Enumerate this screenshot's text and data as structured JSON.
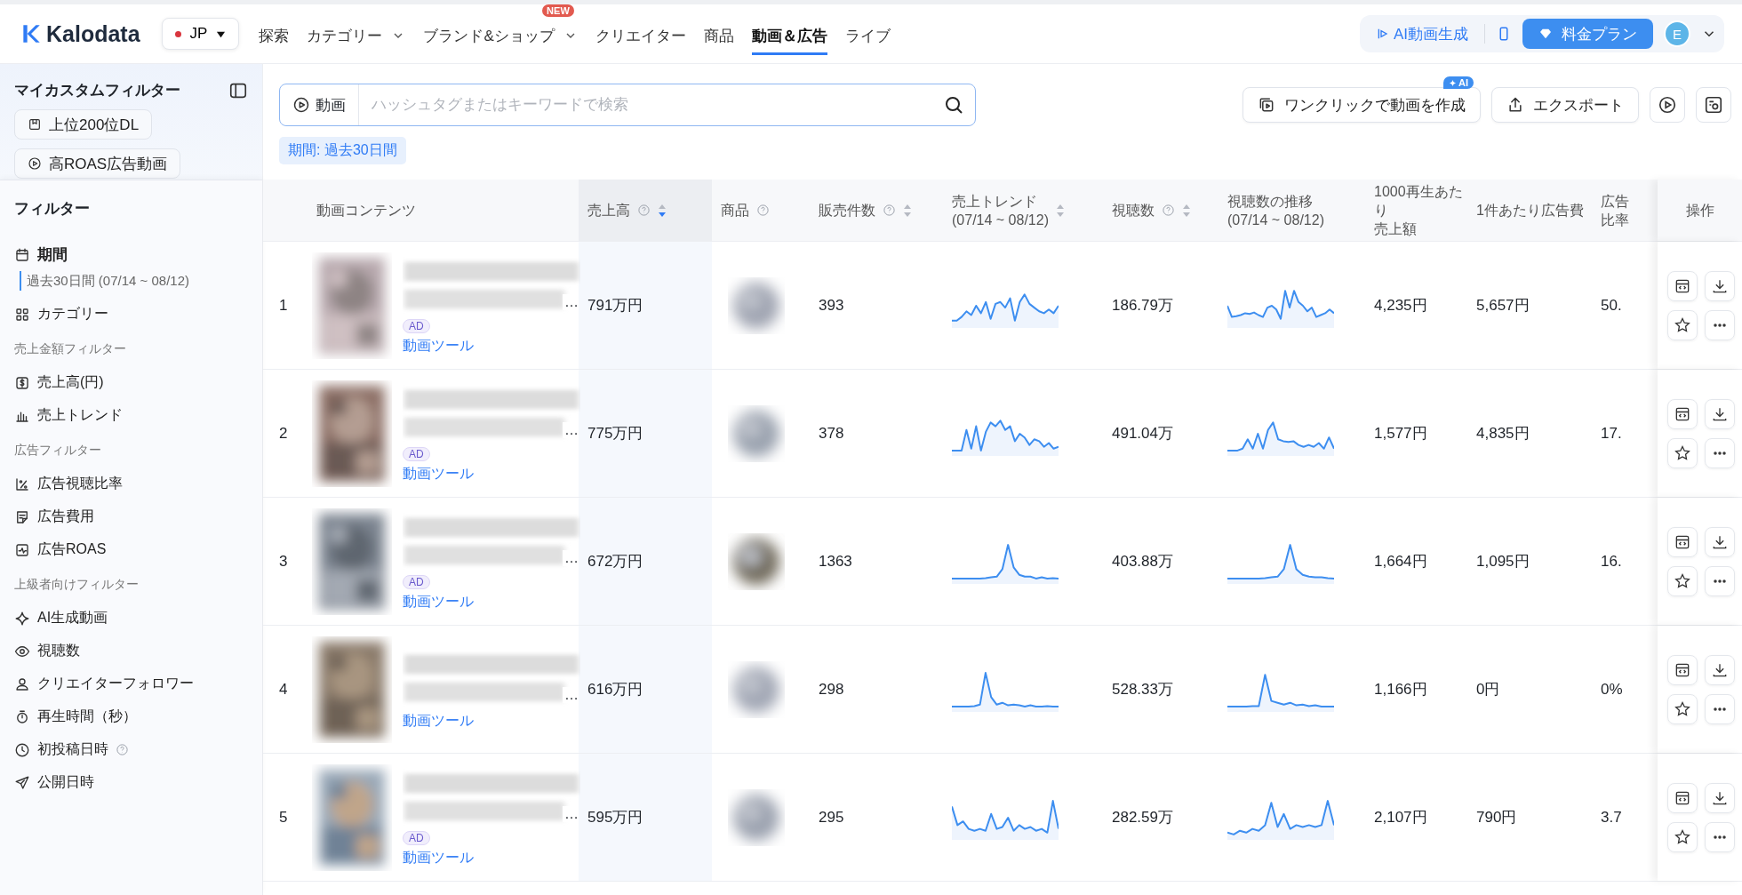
{
  "header": {
    "logo": "Kalodata",
    "region": "JP",
    "nav": [
      {
        "label": "探索",
        "dropdown": false,
        "selected": false
      },
      {
        "label": "カテゴリー",
        "dropdown": true,
        "selected": false
      },
      {
        "label": "ブランド&ショップ",
        "dropdown": true,
        "badge": "NEW",
        "selected": false
      },
      {
        "label": "クリエイター",
        "dropdown": false,
        "selected": false
      },
      {
        "label": "商品",
        "dropdown": false,
        "selected": false
      },
      {
        "label": "動画＆広告",
        "dropdown": false,
        "selected": true
      },
      {
        "label": "ライブ",
        "dropdown": false,
        "selected": false
      }
    ],
    "ai_button": "AI動画生成",
    "plan_button": "料金プラン",
    "avatar": "E"
  },
  "custom_filters": {
    "title": "マイカスタムフィルター",
    "chips": [
      "上位200位DL",
      "高ROAS広告動画"
    ]
  },
  "filters": {
    "title": "フィルター",
    "groups": [
      {
        "items": [
          {
            "label": "期間",
            "active": true,
            "value": "過去30日間 (07/14 ~ 08/12)"
          },
          {
            "label": "カテゴリー",
            "active": false
          }
        ]
      },
      {
        "heading": "売上金額フィルター",
        "items": [
          {
            "label": "売上高(円)",
            "active": false
          },
          {
            "label": "売上トレンド",
            "active": false
          }
        ]
      },
      {
        "heading": "広告フィルター",
        "items": [
          {
            "label": "広告視聴比率",
            "active": false
          },
          {
            "label": "広告費用",
            "active": false
          },
          {
            "label": "広告ROAS",
            "active": false
          }
        ]
      },
      {
        "heading": "上級者向けフィルター",
        "items": [
          {
            "label": "AI生成動画",
            "active": false
          },
          {
            "label": "視聴数",
            "active": false
          },
          {
            "label": "クリエイターフォロワー",
            "active": false
          },
          {
            "label": "再生時間（秒）",
            "active": false
          },
          {
            "label": "初投稿日時",
            "active": false,
            "help": true
          },
          {
            "label": "公開日時",
            "active": false
          }
        ]
      }
    ]
  },
  "search": {
    "scope": "動画",
    "placeholder": "ハッシュタグまたはキーワードで検索"
  },
  "period_tag": "期間: 過去30日間",
  "actions": [
    {
      "label": "ワンクリックで動画を作成",
      "badge": "AI"
    },
    {
      "label": "エクスポート"
    }
  ],
  "table": {
    "columns": [
      {
        "lines": [
          "動画コンテンツ"
        ]
      },
      {
        "lines": [
          "売上高"
        ],
        "help": true,
        "sortable": true,
        "sorted": true
      },
      {
        "lines": [
          "商品"
        ],
        "help": true
      },
      {
        "lines": [
          "販売件数"
        ],
        "help": true,
        "sortable": true,
        "sorted": false
      },
      {
        "lines": [
          "売上トレンド",
          "(07/14 ~ 08/12)"
        ],
        "sortable": true,
        "sorted": false
      },
      {
        "lines": [
          "視聴数"
        ],
        "help": true,
        "sortable": true,
        "sorted": false
      },
      {
        "lines": [
          "視聴数の推移",
          "(07/14 ~ 08/12)"
        ]
      },
      {
        "lines": [
          "1000再生あたり",
          "売上額"
        ]
      },
      {
        "lines": [
          "1件あたり広告費"
        ]
      },
      {
        "lines": [
          "広告",
          "比率"
        ]
      },
      {
        "lines": [
          "操作"
        ]
      }
    ],
    "rows": [
      {
        "rank": "1",
        "title_end": "…",
        "badge": "AD",
        "tool": "動画ツール",
        "sales": "791万円",
        "units": "393",
        "views": "186.79万",
        "per_1000": "4,235円",
        "ad_cost": "5,657円",
        "ad_ratio": "50."
      },
      {
        "rank": "2",
        "title_end": "…",
        "badge": "AD",
        "tool": "動画ツール",
        "sales": "775万円",
        "units": "378",
        "views": "491.04万",
        "per_1000": "1,577円",
        "ad_cost": "4,835円",
        "ad_ratio": "17."
      },
      {
        "rank": "3",
        "title_end": "…",
        "badge": "AD",
        "tool": "動画ツール",
        "sales": "672万円",
        "units": "1363",
        "views": "403.88万",
        "per_1000": "1,664円",
        "ad_cost": "1,095円",
        "ad_ratio": "16."
      },
      {
        "rank": "4",
        "title_end": "…",
        "tool": "動画ツール",
        "sales": "616万円",
        "units": "298",
        "views": "528.33万",
        "per_1000": "1,166円",
        "ad_cost": "0円",
        "ad_ratio": "0%"
      },
      {
        "rank": "5",
        "title_end": "…",
        "badge": "AD",
        "tool": "動画ツール",
        "sales": "595万円",
        "units": "295",
        "views": "282.59万",
        "per_1000": "2,107円",
        "ad_cost": "790円",
        "ad_ratio": "3.7"
      }
    ]
  }
}
